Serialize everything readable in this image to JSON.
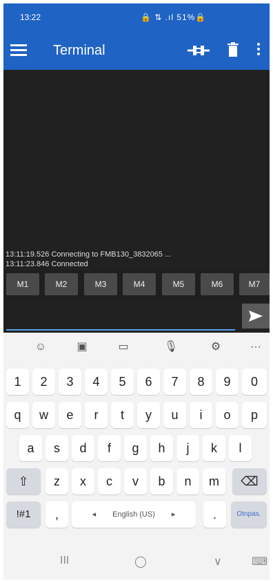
{
  "status_bar": {
    "time": "13:22",
    "system_icons": "🔒 ⇅ .ıl 51%🔒"
  },
  "app_bar": {
    "title": "Terminal"
  },
  "terminal": {
    "lines": [
      "13:11:19.526 Connecting to FMB130_3832065 ...",
      "13:11:23.846 Connected"
    ]
  },
  "macros": [
    "M1",
    "M2",
    "M3",
    "M4",
    "M5",
    "M6",
    "M7"
  ],
  "input": {
    "value": ""
  },
  "keyboard": {
    "toolbar": [
      "☺",
      "▣",
      "▭",
      "🎙",
      "⚙",
      "···"
    ],
    "row_numbers": [
      "1",
      "2",
      "3",
      "4",
      "5",
      "6",
      "7",
      "8",
      "9",
      "0"
    ],
    "row_q": [
      "q",
      "w",
      "e",
      "r",
      "t",
      "y",
      "u",
      "i",
      "o",
      "p"
    ],
    "row_a": [
      "a",
      "s",
      "d",
      "f",
      "g",
      "h",
      "j",
      "k",
      "l"
    ],
    "row_z": [
      "z",
      "x",
      "c",
      "v",
      "b",
      "n",
      "m"
    ],
    "symbols_key": "!#1",
    "comma_key": ",",
    "space_label": "English (US)",
    "period_key": ".",
    "enter_label": "Otnpas.",
    "shift_key": "⇧",
    "backspace_key": "⌫",
    "nav_recents": "III",
    "nav_home": "◯",
    "nav_back": "∨",
    "nav_keyboard": "⌨"
  }
}
